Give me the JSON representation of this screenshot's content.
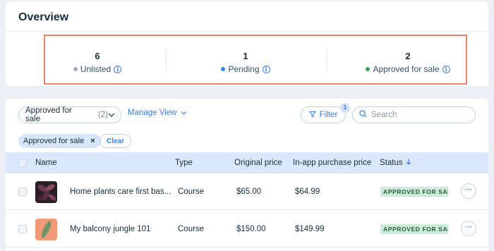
{
  "overview": {
    "title": "Overview",
    "stats": [
      {
        "value": "6",
        "label": "Unlisted",
        "dot_color": "#a8a6bf"
      },
      {
        "value": "1",
        "label": "Pending",
        "dot_color": "#3b7ee8"
      },
      {
        "value": "2",
        "label": "Approved for sale",
        "dot_color": "#33a65b"
      }
    ],
    "highlight_color": "#f0826a"
  },
  "toolbar": {
    "view_select": {
      "label": "Approved for sale",
      "count": "(2)"
    },
    "manage_view": "Manage View",
    "filter": {
      "label": "Filter",
      "badge": "1"
    },
    "search": {
      "placeholder": "Search",
      "value": ""
    }
  },
  "active_filters": {
    "chips": [
      {
        "label": "Approved for sale",
        "remove": "×"
      }
    ],
    "clear_label": "Clear"
  },
  "table": {
    "columns": [
      {
        "label": "Name"
      },
      {
        "label": "Type"
      },
      {
        "label": "Original price"
      },
      {
        "label": "In-app purchase price"
      },
      {
        "label": "Status",
        "sort": "arrow-down-icon"
      }
    ],
    "rows": [
      {
        "name": "Home plants care first bas...",
        "type": "Course",
        "original_price": "$65.00",
        "in_app_price": "$64.99",
        "status": "APPROVED FOR SALE",
        "thumb_icon": "dark-leaves-thumbnail-icon"
      },
      {
        "name": "My balcony jungle 101",
        "type": "Course",
        "original_price": "$150.00",
        "in_app_price": "$149.99",
        "status": "APPROVED FOR SALE",
        "thumb_icon": "single-leaf-thumbnail-icon"
      }
    ],
    "more_label": "···"
  },
  "colors": {
    "accent": "#3b7ee8",
    "header_bg": "#dbe8fc",
    "status_bg": "#cdebd9",
    "page_bg": "#eceff3"
  }
}
